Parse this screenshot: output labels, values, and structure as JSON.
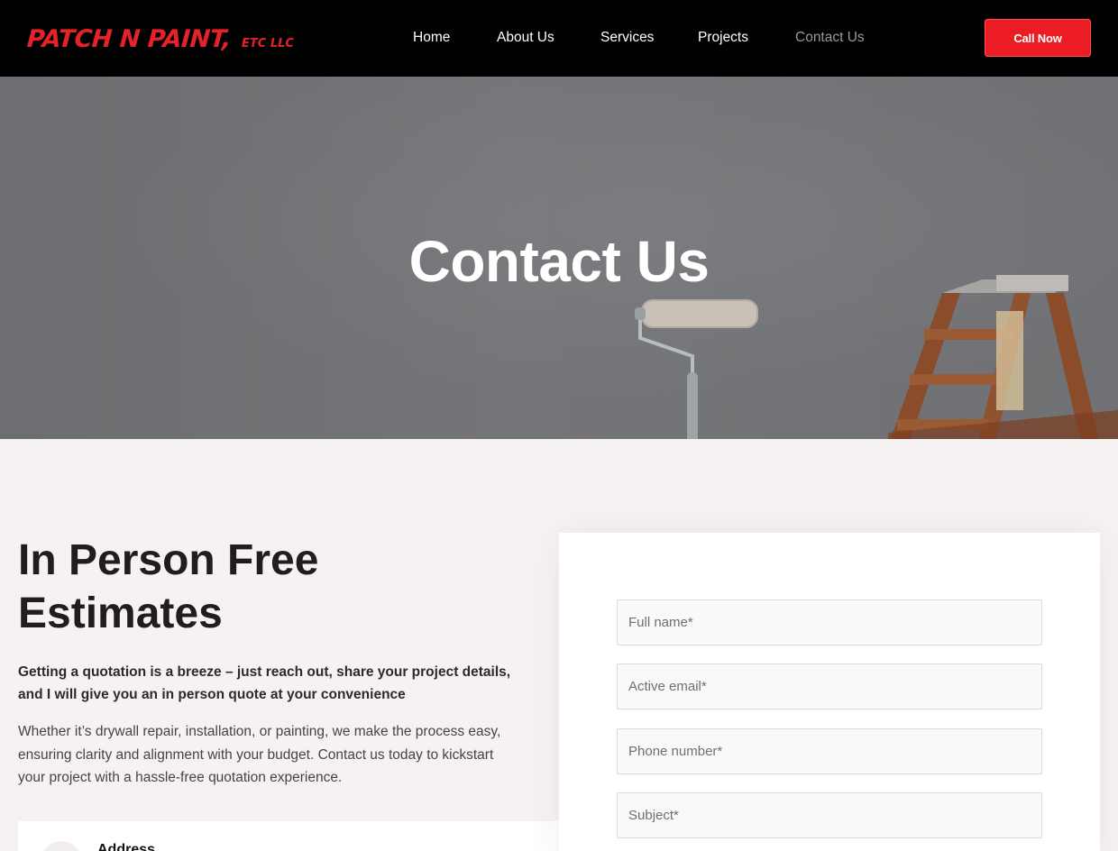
{
  "header": {
    "logo_main": "PATCH N PAINT,",
    "logo_sub": "ETC LLC",
    "nav": [
      {
        "label": "Home",
        "active": false
      },
      {
        "label": "About Us",
        "active": false
      },
      {
        "label": "Services",
        "active": false
      },
      {
        "label": "Projects",
        "active": false
      },
      {
        "label": "Contact Us",
        "active": true
      }
    ],
    "cta_label": "Call Now"
  },
  "hero": {
    "title": "Contact Us"
  },
  "content": {
    "title": "In Person Free Estimates",
    "lead": "Getting a quotation is a breeze – just reach out, share your project details, and I will give you an in person quote at your convenience",
    "body": "Whether it’s drywall repair, installation, or painting, we make the process easy, ensuring clarity and alignment with your budget. Contact us today to kickstart your project with a hassle-free quotation experience.",
    "address_label": "Address"
  },
  "form": {
    "full_name_placeholder": "Full name*",
    "email_placeholder": "Active email*",
    "phone_placeholder": "Phone number*",
    "subject_placeholder": "Subject*"
  },
  "colors": {
    "brand_red": "#ec1c24",
    "header_bg": "#000000",
    "page_bg": "#f6f2f3",
    "heading": "#241b1f"
  }
}
